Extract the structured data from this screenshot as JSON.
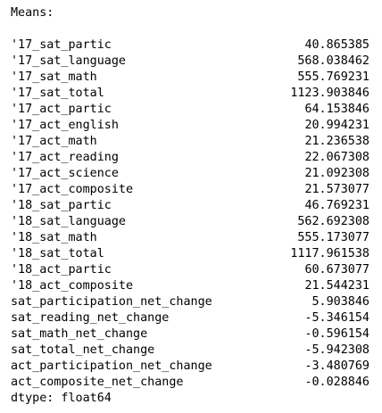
{
  "header": "Means:",
  "rows": [
    {
      "key": "'17_sat_partic",
      "value": "40.865385"
    },
    {
      "key": "'17_sat_language",
      "value": "568.038462"
    },
    {
      "key": "'17_sat_math",
      "value": "555.769231"
    },
    {
      "key": "'17_sat_total",
      "value": "1123.903846"
    },
    {
      "key": "'17_act_partic",
      "value": "64.153846"
    },
    {
      "key": "'17_act_english",
      "value": "20.994231"
    },
    {
      "key": "'17_act_math",
      "value": "21.236538"
    },
    {
      "key": "'17_act_reading",
      "value": "22.067308"
    },
    {
      "key": "'17_act_science",
      "value": "21.092308"
    },
    {
      "key": "'17_act_composite",
      "value": "21.573077"
    },
    {
      "key": "'18_sat_partic",
      "value": "46.769231"
    },
    {
      "key": "'18_sat_language",
      "value": "562.692308"
    },
    {
      "key": "'18_sat_math",
      "value": "555.173077"
    },
    {
      "key": "'18_sat_total",
      "value": "1117.961538"
    },
    {
      "key": "'18_act_partic",
      "value": "60.673077"
    },
    {
      "key": "'18_act_composite",
      "value": "21.544231"
    },
    {
      "key": "sat_participation_net_change",
      "value": "5.903846"
    },
    {
      "key": "sat_reading_net_change",
      "value": "-5.346154"
    },
    {
      "key": "sat_math_net_change",
      "value": "-0.596154"
    },
    {
      "key": "sat_total_net_change",
      "value": "-5.942308"
    },
    {
      "key": "act_participation_net_change",
      "value": "-3.480769"
    },
    {
      "key": "act_composite_net_change",
      "value": "-0.028846"
    }
  ],
  "footer": "dtype: float64"
}
